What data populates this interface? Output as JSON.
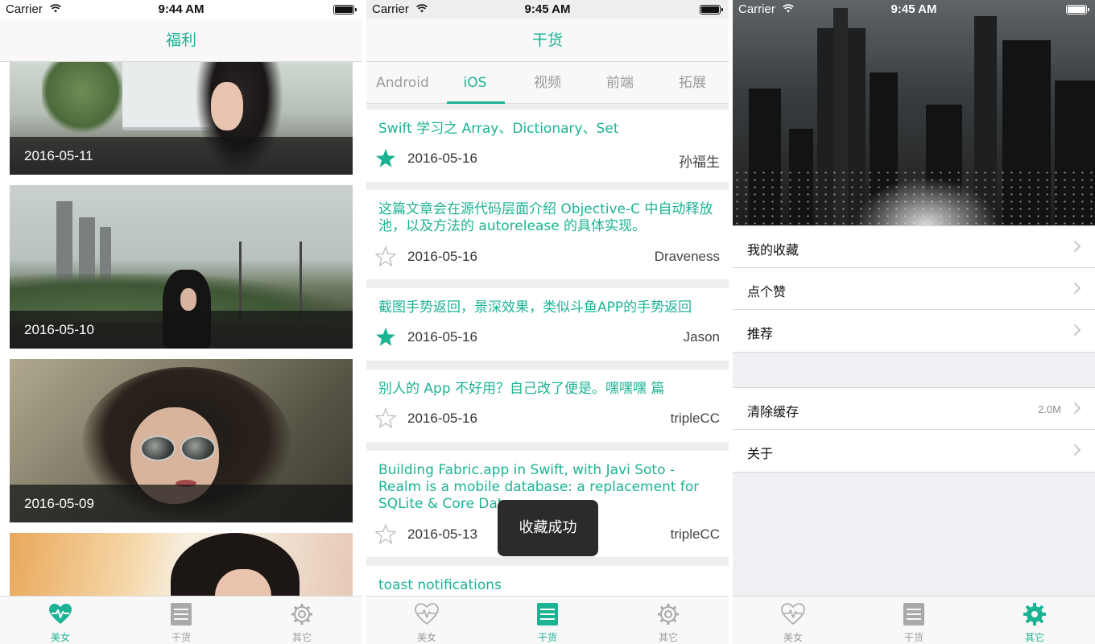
{
  "status": [
    {
      "carrier": "Carrier",
      "time": "9:44 AM"
    },
    {
      "carrier": "Carrier",
      "time": "9:45 AM"
    },
    {
      "carrier": "Carrier",
      "time": "9:45 AM"
    }
  ],
  "screen1": {
    "title": "福利",
    "photos": [
      "2016-05-11",
      "2016-05-10",
      "2016-05-09"
    ]
  },
  "screen2": {
    "title": "干货",
    "tabs": [
      "Android",
      "iOS",
      "视频",
      "前端",
      "拓展"
    ],
    "active_tab": "iOS",
    "articles": [
      {
        "title": "Swift 学习之 Array、Dictionary、Set",
        "date": "2016-05-16",
        "author": "孙福生",
        "starred": true
      },
      {
        "title": "这篇文章会在源代码层面介绍 Objective-C 中自动释放池，以及方法的 autorelease 的具体实现。",
        "date": "2016-05-16",
        "author": "Draveness",
        "starred": false
      },
      {
        "title": "截图手势返回，景深效果，类似斗鱼APP的手势返回",
        "date": "2016-05-16",
        "author": "Jason",
        "starred": true
      },
      {
        "title": "别人的 App 不好用？自己改了便是。嘿嘿嘿 篇",
        "date": "2016-05-16",
        "author": "tripleCC",
        "starred": false
      },
      {
        "title": "Building Fabric.app in Swift, with Javi Soto - Realm is a mobile database: a replacement for SQLite & Core Data",
        "date": "2016-05-13",
        "author": "tripleCC",
        "starred": false
      },
      {
        "title": "toast notifications"
      }
    ],
    "toast": "收藏成功"
  },
  "screen3": {
    "group1": [
      {
        "label": "我的收藏"
      },
      {
        "label": "点个赞"
      },
      {
        "label": "推荐"
      }
    ],
    "group2": [
      {
        "label": "清除缓存",
        "value": "2.0M"
      },
      {
        "label": "关于"
      }
    ]
  },
  "tabbar": {
    "items": [
      {
        "label": "美女",
        "icon": "heartbeat-icon"
      },
      {
        "label": "干货",
        "icon": "list-icon"
      },
      {
        "label": "其它",
        "icon": "gear-icon"
      }
    ],
    "active": [
      "美女",
      "干货",
      "其它"
    ]
  },
  "colors": {
    "accent": "#1cb394",
    "inactive": "#9b9b9b",
    "star_empty": "#bdbdbd"
  }
}
